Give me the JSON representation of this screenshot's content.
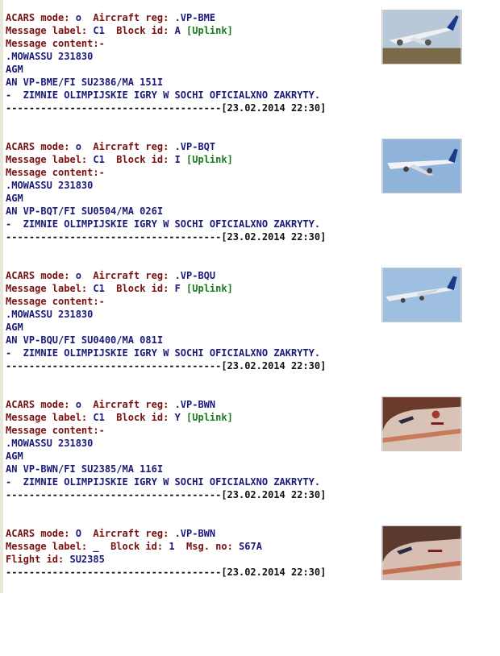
{
  "messages": [
    {
      "mode_label": "ACARS mode:",
      "mode": "o",
      "reg_label": "Aircraft reg:",
      "reg": ".VP-BME",
      "msglabel_label": "Message label:",
      "msglabel": "C1",
      "block_label": "Block id:",
      "block": "A",
      "direction": "[Uplink]",
      "content_label": "Message content:-",
      "content": [
        ".MOWASSU 231830",
        "AGM",
        "AN VP-BME/FI SU2386/MA 151I",
        "-  ZIMNIE OLIMPIJSKIE IGRY W SOCHI OFICIALXNO ZAKRYTY."
      ],
      "separator": "-------------------------------------",
      "timestamp": "[23.02.2014 22:30]",
      "photo_icon": "aircraft-photo-icon"
    },
    {
      "mode_label": "ACARS mode:",
      "mode": "o",
      "reg_label": "Aircraft reg:",
      "reg": ".VP-BQT",
      "msglabel_label": "Message label:",
      "msglabel": "C1",
      "block_label": "Block id:",
      "block": "I",
      "direction": "[Uplink]",
      "content_label": "Message content:-",
      "content": [
        ".MOWASSU 231830",
        "AGM",
        "AN VP-BQT/FI SU0504/MA 026I",
        "-  ZIMNIE OLIMPIJSKIE IGRY W SOCHI OFICIALXNO ZAKRYTY."
      ],
      "separator": "-------------------------------------",
      "timestamp": "[23.02.2014 22:30]",
      "photo_icon": "aircraft-photo-icon"
    },
    {
      "mode_label": "ACARS mode:",
      "mode": "o",
      "reg_label": "Aircraft reg:",
      "reg": ".VP-BQU",
      "msglabel_label": "Message label:",
      "msglabel": "C1",
      "block_label": "Block id:",
      "block": "F",
      "direction": "[Uplink]",
      "content_label": "Message content:-",
      "content": [
        ".MOWASSU 231830",
        "AGM",
        "AN VP-BQU/FI SU0400/MA 081I",
        "-  ZIMNIE OLIMPIJSKIE IGRY W SOCHI OFICIALXNO ZAKRYTY."
      ],
      "separator": "-------------------------------------",
      "timestamp": "[23.02.2014 22:30]",
      "photo_icon": "aircraft-photo-icon"
    },
    {
      "mode_label": "ACARS mode:",
      "mode": "o",
      "reg_label": "Aircraft reg:",
      "reg": ".VP-BWN",
      "msglabel_label": "Message label:",
      "msglabel": "C1",
      "block_label": "Block id:",
      "block": "Y",
      "direction": "[Uplink]",
      "content_label": "Message content:-",
      "content": [
        ".MOWASSU 231830",
        "AGM",
        "AN VP-BWN/FI SU2385/MA 116I",
        "-  ZIMNIE OLIMPIJSKIE IGRY W SOCHI OFICIALXNO ZAKRYTY."
      ],
      "separator": "-------------------------------------",
      "timestamp": "[23.02.2014 22:30]",
      "photo_icon": "aircraft-photo-icon"
    }
  ],
  "last_message": {
    "mode_label": "ACARS mode:",
    "mode": "O",
    "reg_label": "Aircraft reg:",
    "reg": ".VP-BWN",
    "msglabel_label": "Message label:",
    "msglabel": "_",
    "block_label": "Block id:",
    "block": "1",
    "msgno_label": "Msg. no:",
    "msgno": "S67A",
    "flight_label": "Flight id:",
    "flight": "SU2385",
    "separator": "-------------------------------------",
    "timestamp": "[23.02.2014 22:30]",
    "photo_icon": "aircraft-photo-icon"
  },
  "colors": {
    "label": "#7a1010",
    "value": "#1a1a7a",
    "uplink": "#1a7a1a"
  }
}
